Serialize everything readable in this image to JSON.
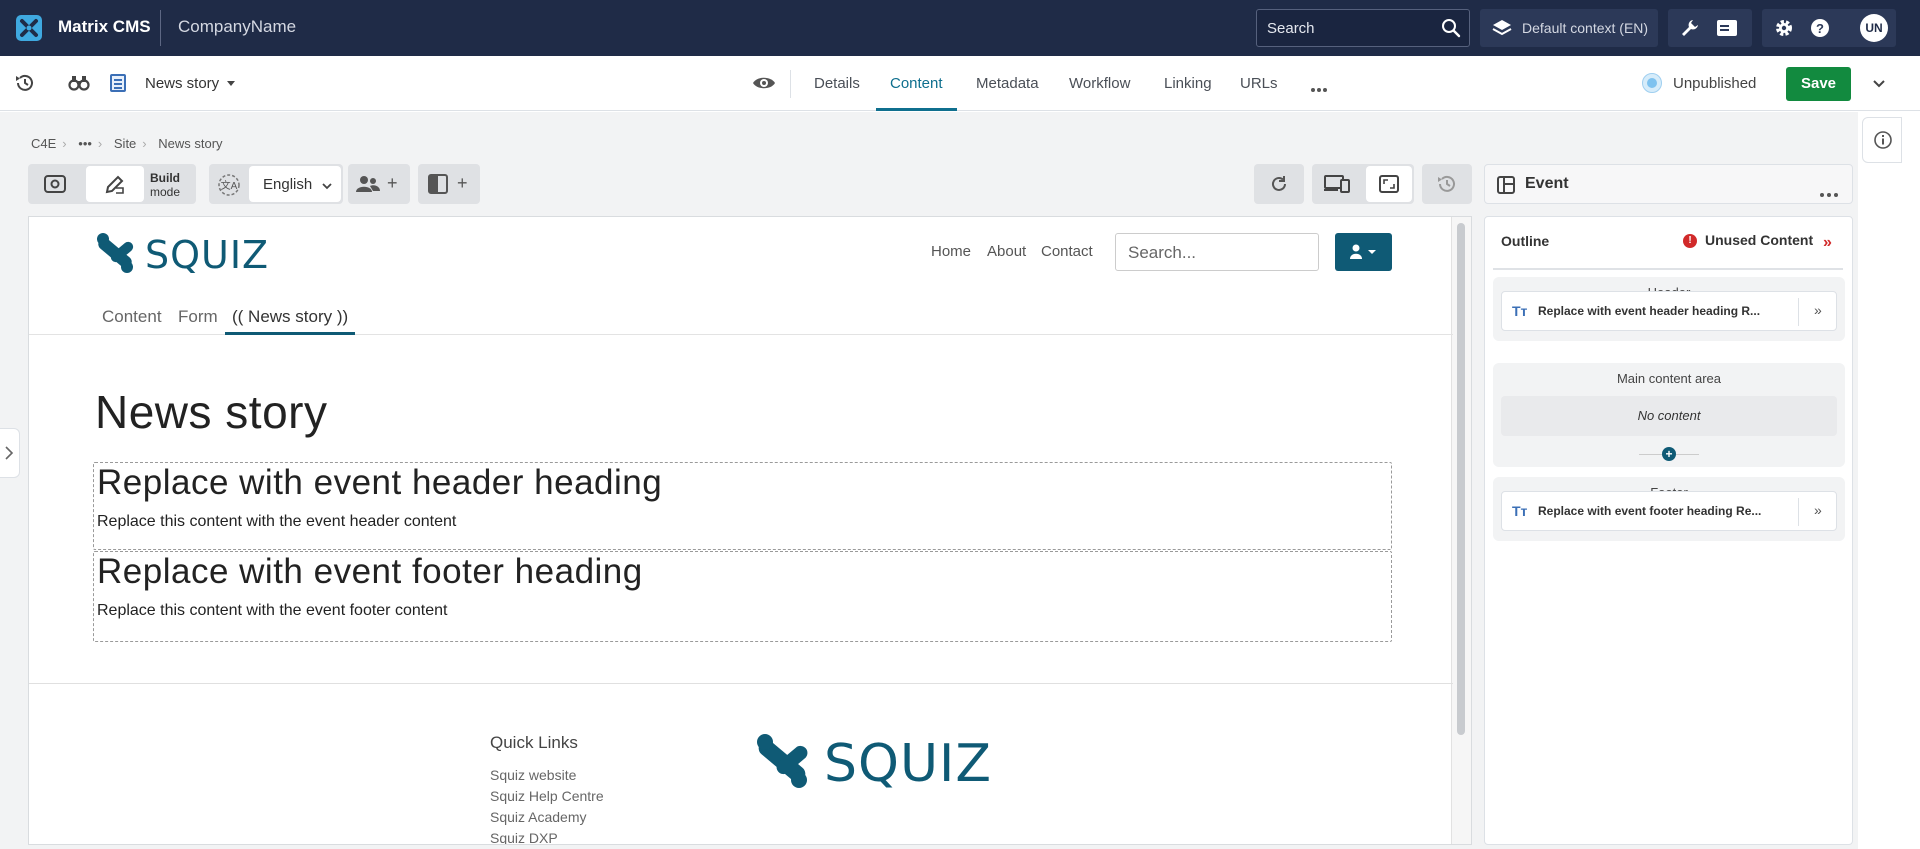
{
  "topbar": {
    "app_name": "Matrix CMS",
    "company": "CompanyName",
    "search_label": "Search",
    "context_label": "Default context (EN)",
    "avatar_initials": "UN"
  },
  "toolbar": {
    "asset_name": "News story",
    "tabs": [
      "Details",
      "Content",
      "Metadata",
      "Workflow",
      "Linking",
      "URLs"
    ],
    "active_tab": "Content",
    "more_label": "•••",
    "status": "Unpublished",
    "save_label": "Save"
  },
  "breadcrumb": [
    "C4E",
    "•••",
    "Site",
    "News story"
  ],
  "editor": {
    "build_label": "Build",
    "mode_label": "mode",
    "language": "English",
    "plus": "+"
  },
  "preview": {
    "nav": [
      "Home",
      "About",
      "Contact"
    ],
    "search_placeholder": "Search...",
    "tabs": [
      "Content",
      "Form",
      "(( News story ))"
    ],
    "page_title": "News story",
    "blocks": [
      {
        "heading": "Replace with event header heading",
        "body": "Replace this content with the event header content"
      },
      {
        "heading": "Replace with event footer heading",
        "body": "Replace this content with the event footer content"
      }
    ],
    "quick_links_title": "Quick Links",
    "quick_links": [
      "Squiz website",
      "Squiz Help Centre",
      "Squiz Academy",
      "Squiz DXP"
    ]
  },
  "panel": {
    "title": "Event",
    "outline_label": "Outline",
    "unused_label": "Unused Content",
    "sections": [
      {
        "title": "Header",
        "items": [
          "Replace with event header heading R..."
        ]
      },
      {
        "title": "Main content area",
        "items": [],
        "empty_label": "No content"
      },
      {
        "title": "Footer",
        "items": [
          "Replace with event footer heading Re..."
        ]
      }
    ]
  },
  "colors": {
    "topbar": "#1f2b47",
    "accent": "#0f6f8e",
    "save": "#128a3f",
    "alert": "#d12a2a"
  }
}
